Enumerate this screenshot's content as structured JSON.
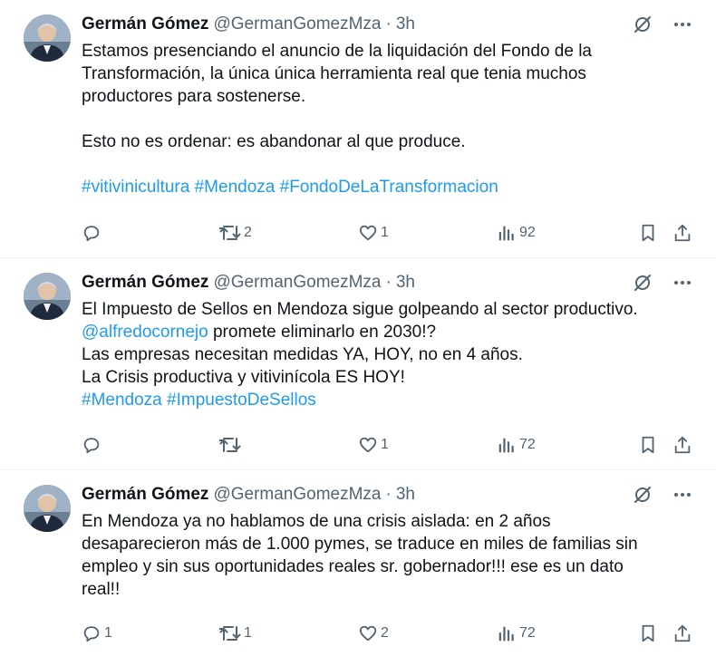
{
  "tweets": [
    {
      "author": "Germán Gómez",
      "handle": "@GermanGomezMza",
      "separator": "·",
      "time": "3h",
      "lines": [
        [
          {
            "t": "Estamos presenciando el anuncio de la liquidación del Fondo de la"
          }
        ],
        [
          {
            "t": "Transformación, la única única herramienta real que tenia muchos"
          }
        ],
        [
          {
            "t": "productores para sostenerse."
          }
        ],
        [],
        [
          {
            "t": "Esto no es ordenar: es abandonar al que produce."
          }
        ],
        [],
        [
          {
            "t": "#vitivinicultura",
            "k": "tag"
          },
          {
            "t": " "
          },
          {
            "t": "#Mendoza",
            "k": "tag"
          },
          {
            "t": " "
          },
          {
            "t": "#FondoDeLaTransformacion",
            "k": "tag"
          }
        ]
      ],
      "replies": "",
      "retweets": "2",
      "likes": "1",
      "views": "92"
    },
    {
      "author": "Germán Gómez",
      "handle": "@GermanGomezMza",
      "separator": "·",
      "time": "3h",
      "lines": [
        [
          {
            "t": "El Impuesto de Sellos en Mendoza sigue golpeando al sector productivo."
          }
        ],
        [
          {
            "t": "@alfredocornejo",
            "k": "mention"
          },
          {
            "t": " promete eliminarlo en 2030!?"
          }
        ],
        [
          {
            "t": "Las empresas necesitan medidas YA, HOY, no en 4 años."
          }
        ],
        [
          {
            "t": "La Crisis productiva y vitivinícola ES HOY!"
          }
        ],
        [
          {
            "t": "#Mendoza",
            "k": "tag"
          },
          {
            "t": " "
          },
          {
            "t": "#ImpuestoDeSellos",
            "k": "tag"
          }
        ]
      ],
      "replies": "",
      "retweets": "",
      "likes": "1",
      "views": "72"
    },
    {
      "author": "Germán Gómez",
      "handle": "@GermanGomezMza",
      "separator": "·",
      "time": "3h",
      "lines": [
        [
          {
            "t": "En Mendoza ya no hablamos de una crisis aislada: en 2 años"
          }
        ],
        [
          {
            "t": "desaparecieron más de 1.000 pymes, se traduce en miles de familias sin"
          }
        ],
        [
          {
            "t": "empleo y sin sus oportunidades reales sr. gobernador!!! ese es un dato"
          }
        ],
        [
          {
            "t": "real!!"
          }
        ]
      ],
      "replies": "1",
      "retweets": "1",
      "likes": "2",
      "views": "72"
    }
  ],
  "icons": {
    "grok": "grok-icon",
    "more": "more-options-icon",
    "reply": "reply-icon",
    "retweet": "retweet-icon",
    "like": "heart-icon",
    "views": "views-chart-icon",
    "bookmark": "bookmark-icon",
    "share": "share-icon"
  },
  "colors": {
    "text": "#0f1419",
    "secondary": "#536471",
    "link": "#1d9bf0",
    "divider": "#eff3f4"
  }
}
